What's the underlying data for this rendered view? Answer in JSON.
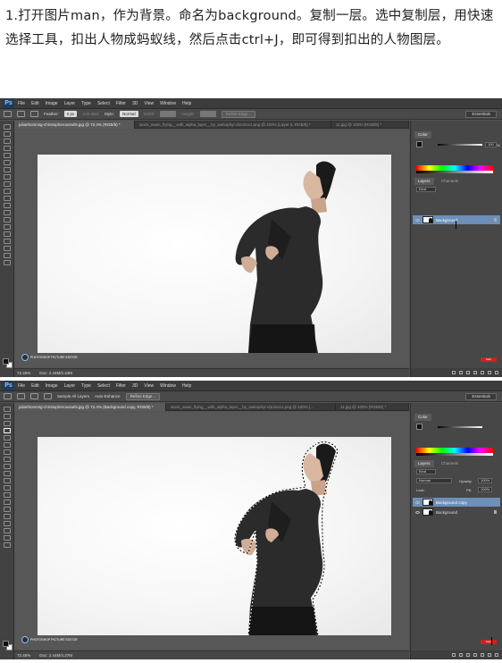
{
  "intro": {
    "text": "1.打开图片man，作为背景。命名为background。复制一层。选中复制层，用快速选择工具，扣出人物成蚂蚁线，然后点击ctrl+J，即可得到扣出的人物图层。"
  },
  "shot1": {
    "app_logo": "Ps",
    "menu": [
      "File",
      "Edit",
      "Image",
      "Layer",
      "Type",
      "Select",
      "Filter",
      "3D",
      "View",
      "Window",
      "Help"
    ],
    "options": {
      "feather_label": "Feather:",
      "feather_value": "0 px",
      "antialias_label": "Anti-alias",
      "style_label": "Style:",
      "style_value": "Normal",
      "width_label": "Width:",
      "height_label": "Height:",
      "refine_edge": "Refine Edge..."
    },
    "workspace": "Essentials",
    "tabs": [
      "julianhommig-christopheroussel5.jpg @ 72.4% (RGB/8) *",
      "stock_swan_flying__with_alpha_layer__by_wetiophyr-d1i42sx1.png @ 100% (Layer 0, RGB/8) *",
      "11.jpg @ 100% (RGB/8) *"
    ],
    "status_zoom": "72.45%",
    "status_doc": "Doc: 2.44M/2.44M",
    "panels": {
      "color_tab": "Color",
      "color_value": "100",
      "color_unit": "%",
      "layers_tab": "Layers",
      "channels_tab": "Channels",
      "kind_label": "Kind",
      "layers": [
        {
          "name": "Background",
          "selected": true,
          "locked": true
        }
      ]
    },
    "watermark": "PHOTOSHOP PICTURE EDITOR",
    "red_button": "Start"
  },
  "shot2": {
    "app_logo": "Ps",
    "menu": [
      "File",
      "Edit",
      "Image",
      "Layer",
      "Type",
      "Select",
      "Filter",
      "3D",
      "View",
      "Window",
      "Help"
    ],
    "options": {
      "sample_all": "Sample All Layers",
      "auto_enhance": "Auto-Enhance",
      "refine_edge": "Refine Edge..."
    },
    "workspace": "Essentials",
    "tabs": [
      "julianhommig-christopheroussel5.jpg @ 72.4% (Background copy, RGB/8) *",
      "stock_swan_flying__with_alpha_layer__by_wetiophyr-d1i42sx1.png @ 100% (...",
      "11.jpg @ 100% (RGB/8) *"
    ],
    "status_zoom": "72.45%",
    "status_doc": "Doc: 2.44M/4.27M",
    "panels": {
      "color_tab": "Color",
      "layers_tab": "Layers",
      "channels_tab": "Channels",
      "kind_label": "Kind",
      "blend_mode": "Normal",
      "opacity_label": "Opacity:",
      "opacity_value": "100%",
      "lock_label": "Lock:",
      "fill_label": "Fill:",
      "fill_value": "100%",
      "layers": [
        {
          "name": "Background copy",
          "selected": true,
          "locked": false
        },
        {
          "name": "Background",
          "selected": false,
          "locked": true
        }
      ]
    },
    "watermark": "PHOTOSHOP PICTURE EDITOR",
    "red_button": "Start"
  }
}
